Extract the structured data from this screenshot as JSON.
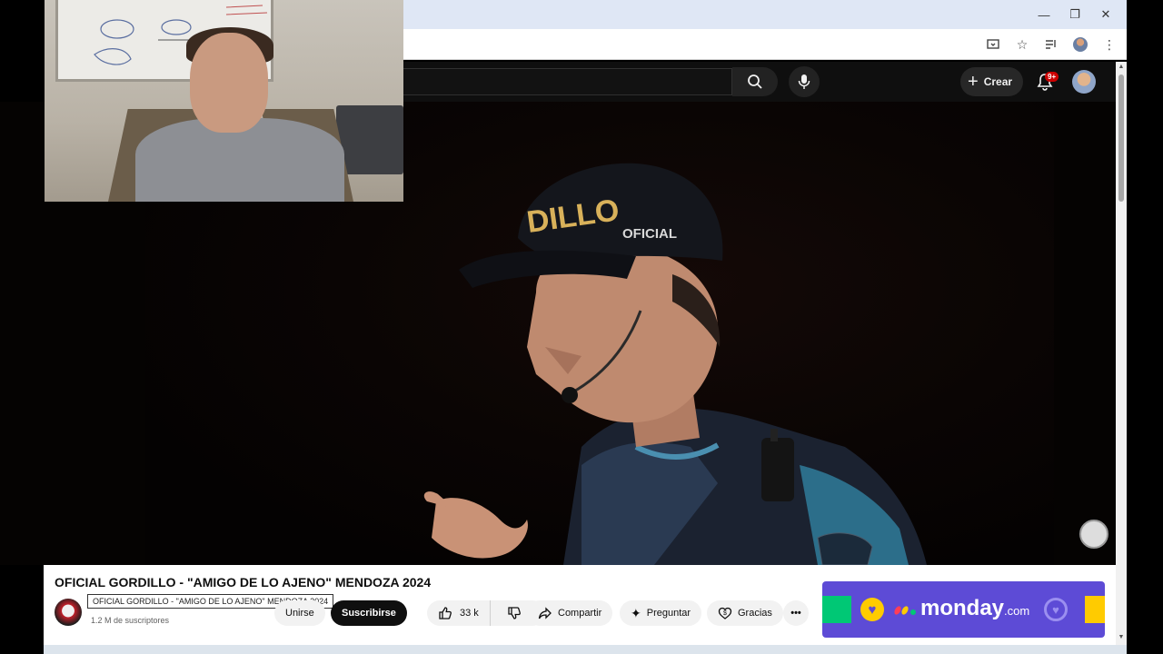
{
  "browser": {
    "window_controls": [
      "minimize",
      "restore",
      "close"
    ],
    "toolbar_icons": [
      "install-icon",
      "bookmark-star-icon",
      "media-control-icon",
      "profile-avatar",
      "menu-dots-icon"
    ]
  },
  "youtube_header": {
    "create_label": "Crear",
    "notification_badge": "9+"
  },
  "video": {
    "title": "OFICIAL GORDILLO - \"AMIGO DE LO AJENO\" MENDOZA 2024"
  },
  "channel": {
    "subscribers": "1.2 M de suscriptores",
    "tooltip": "OFICIAL GORDILLO - \"AMIGO DE LO AJENO\" MENDOZA 2024",
    "join_label": "Unirse",
    "subscribe_label": "Suscribirse"
  },
  "actions": {
    "likes": "33 k",
    "share_label": "Compartir",
    "ask_label": "Preguntar",
    "thanks_label": "Gracias",
    "more_label": "•••"
  },
  "ad": {
    "brand": "monday",
    "brand_suffix": ".com"
  },
  "colors": {
    "youtube_dark": "#0f0f0f",
    "subscribe_button": "#0f0f0f",
    "ad_background": "#5d4bd6",
    "notification_red": "#cc0000"
  }
}
